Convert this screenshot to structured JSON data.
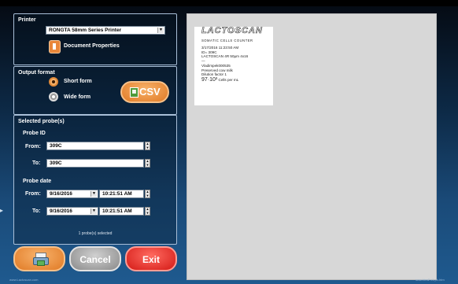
{
  "printer": {
    "title": "Printer",
    "selected": "RONGTA 58mm Series Printer",
    "doc_props": "Document Properties"
  },
  "output": {
    "title": "Output format",
    "short_form": "Short form",
    "wide_form": "Wide form",
    "csv": "CSV"
  },
  "probes": {
    "title": "Selected probe(s)",
    "probe_id": "Probe ID",
    "from_label": "From:",
    "from_value": "309C",
    "to_label": "To:",
    "to_value": "309C",
    "probe_date": "Probe date",
    "date_from_label": "From:",
    "date_from": "9/16/2016",
    "time_from": "10:21:51 AM",
    "date_to_label": "To:",
    "date_to": "9/16/2016",
    "time_to": "10:21:51 AM",
    "count_text": "1 probe(s) selected"
  },
  "buttons": {
    "cancel": "Cancel",
    "exit": "Exit"
  },
  "receipt": {
    "brand": "LACTOSCAN",
    "subtitle": "SOMATIC CELLS COUNTER",
    "line1": "3/17/2016 11:23:50 AM",
    "line2": "ID= 309C",
    "line3": "LACTOSCAN 4R 50µm 4x16",
    "line4": "—",
    "line5": "Vladimpek000535",
    "line6": "Preserved cow milk",
    "line7": "Dilution factor 1",
    "result_value": "97·10³",
    "result_unit": "Cells per mL"
  },
  "footer": {
    "left": "www.Lactoscan.com",
    "right": "scsc.htm2 v1.ph.htm"
  },
  "colors": {
    "orange": "#e9873a",
    "gray": "#9a9a9a",
    "red": "#e0302a",
    "panel_border": "#a9bfd8"
  }
}
